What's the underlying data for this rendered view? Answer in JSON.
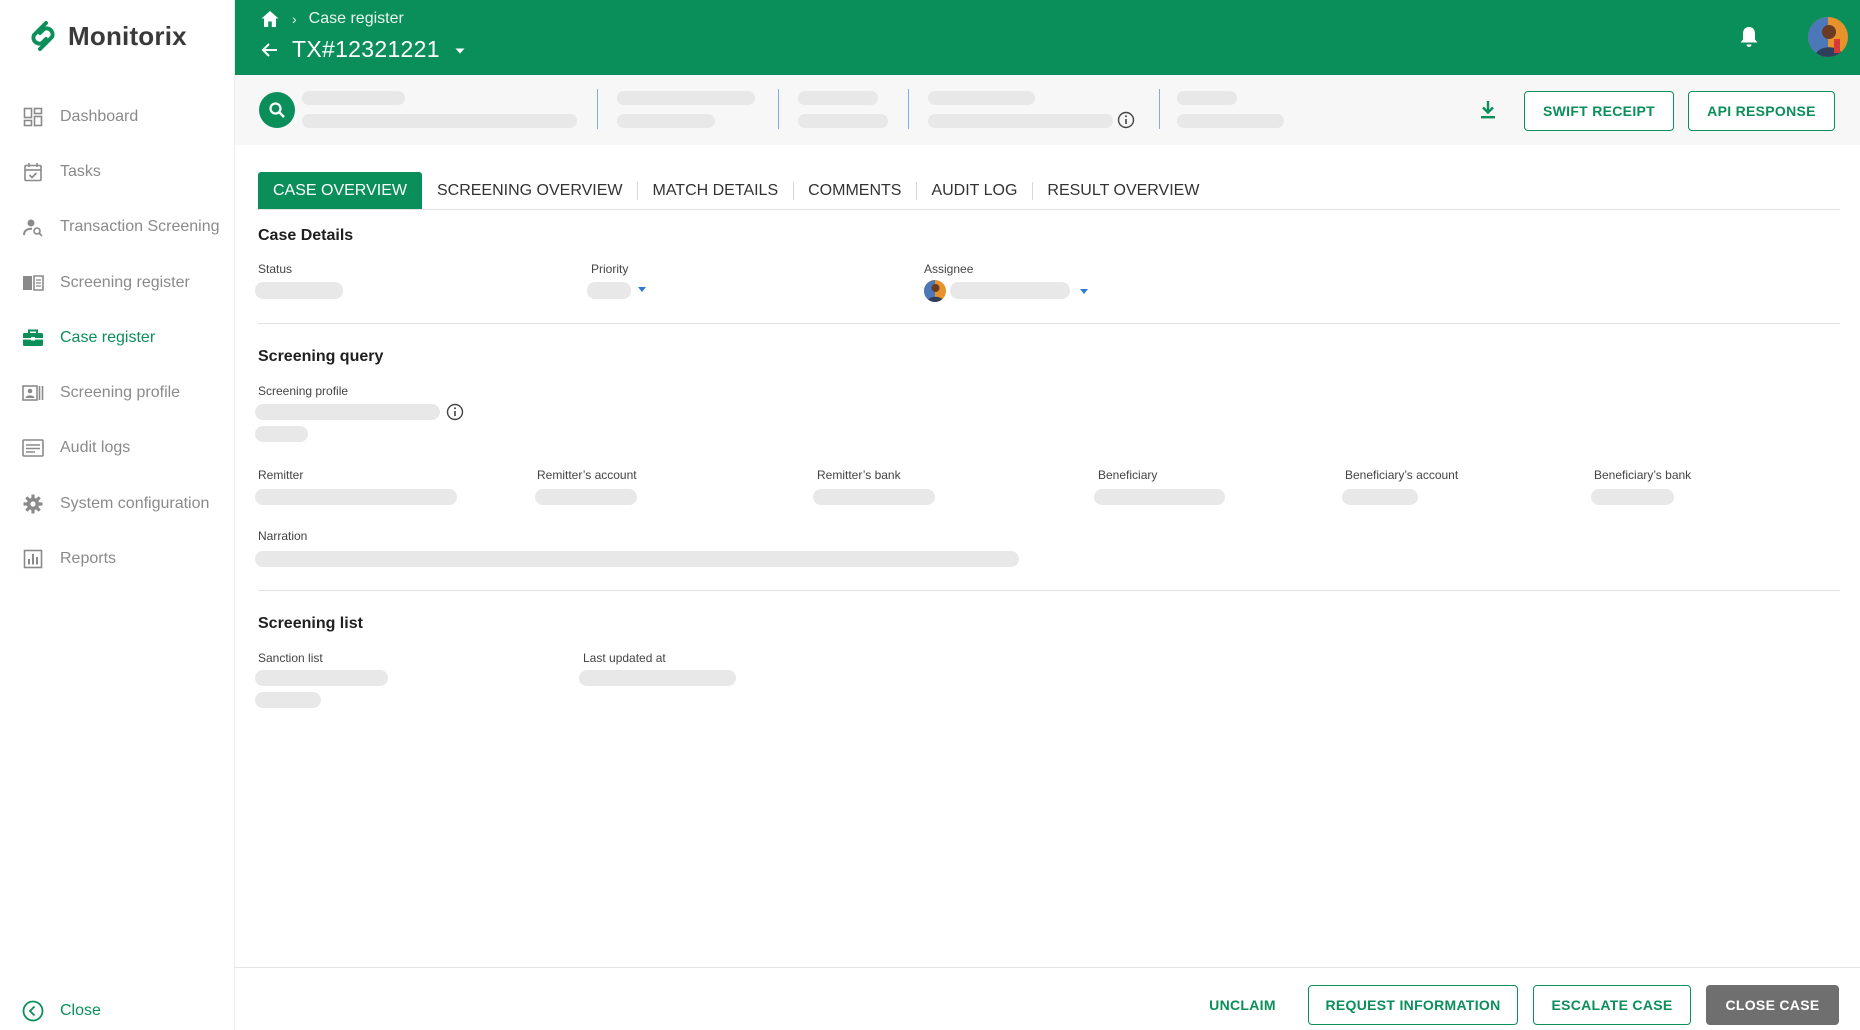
{
  "app": {
    "name": "Monitorix",
    "brand_color": "#0b8f5a"
  },
  "sidebar": {
    "items": [
      {
        "label": "Dashboard",
        "icon": "dashboard-icon"
      },
      {
        "label": "Tasks",
        "icon": "calendar-check-icon"
      },
      {
        "label": "Transaction Screening",
        "icon": "person-search-icon"
      },
      {
        "label": "Screening register",
        "icon": "book-icon"
      },
      {
        "label": "Case register",
        "icon": "briefcase-icon",
        "active": true
      },
      {
        "label": "Screening profile",
        "icon": "profile-card-icon"
      },
      {
        "label": "Audit logs",
        "icon": "list-icon"
      },
      {
        "label": "System configuration",
        "icon": "gear-icon"
      },
      {
        "label": "Reports",
        "icon": "bar-chart-icon"
      }
    ],
    "close_label": "Close"
  },
  "header": {
    "breadcrumb": "Case register",
    "title": "TX#12321221"
  },
  "summary": {
    "swift_receipt": "SWIFT RECEIPT",
    "api_response": "API RESPONSE"
  },
  "tabs": [
    {
      "label": "CASE OVERVIEW",
      "active": true
    },
    {
      "label": "SCREENING OVERVIEW"
    },
    {
      "label": "MATCH DETAILS"
    },
    {
      "label": "COMMENTS"
    },
    {
      "label": "AUDIT LOG"
    },
    {
      "label": "RESULT OVERVIEW"
    }
  ],
  "case_details": {
    "title": "Case Details",
    "status_label": "Status",
    "priority_label": "Priority",
    "assignee_label": "Assignee"
  },
  "screening_query": {
    "title": "Screening query",
    "profile_label": "Screening profile",
    "remitter_label": "Remitter",
    "remitter_account_label": "Remitter’s account",
    "remitter_bank_label": "Remitter’s bank",
    "beneficiary_label": "Beneficiary",
    "beneficiary_account_label": "Beneficiary’s account",
    "beneficiary_bank_label": "Beneficiary’s bank",
    "narration_label": "Narration"
  },
  "screening_list": {
    "title": "Screening list",
    "sanction_label": "Sanction list",
    "last_updated_label": "Last updated at"
  },
  "footer": {
    "unclaim": "UNCLAIM",
    "request_information": "REQUEST INFORMATION",
    "escalate_case": "ESCALATE CASE",
    "close_case": "CLOSE CASE"
  }
}
